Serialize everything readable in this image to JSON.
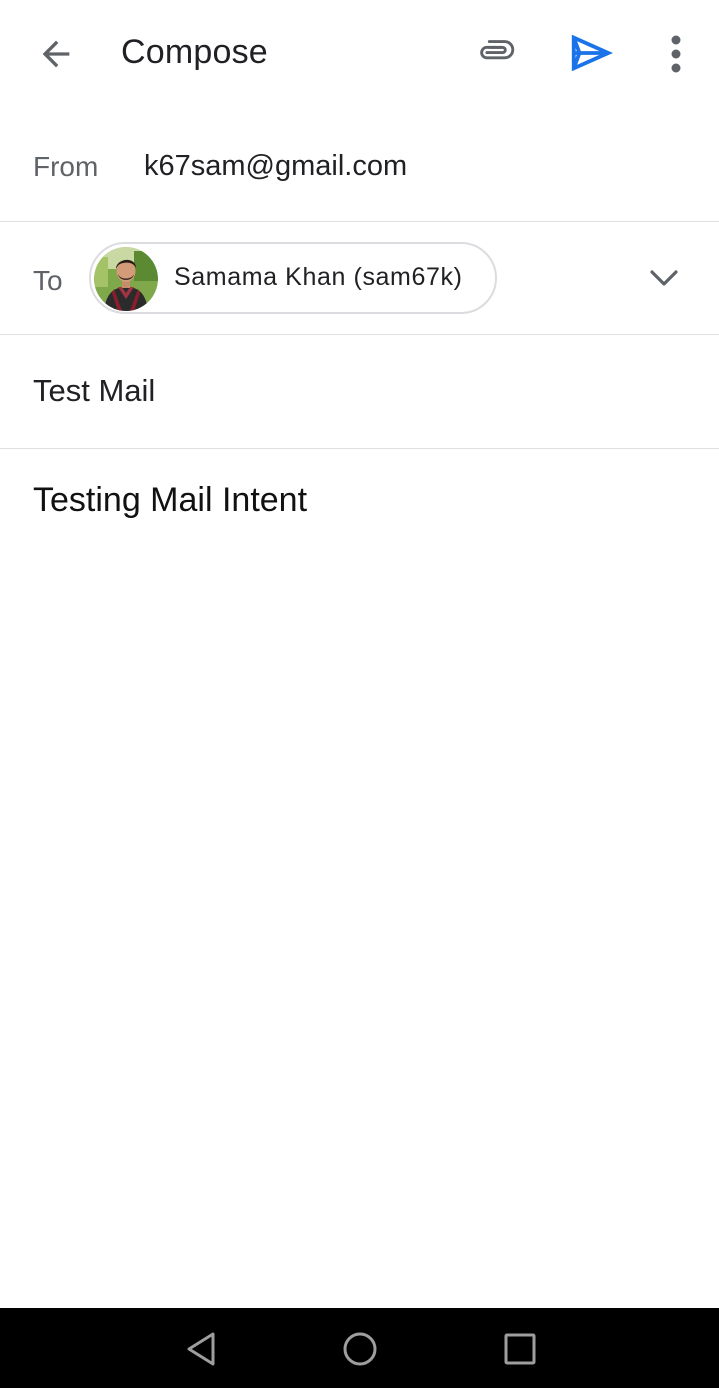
{
  "header": {
    "title": "Compose",
    "icons": {
      "back": "arrow-back-icon",
      "attach": "paperclip-icon",
      "send": "send-icon",
      "more": "more-vert-icon"
    },
    "send_color": "#1a73e8"
  },
  "from": {
    "label": "From",
    "value": "k67sam@gmail.com"
  },
  "to": {
    "label": "To",
    "recipients": [
      {
        "display": "Samama Khan (sam67k)",
        "avatar": "avatar-photo"
      }
    ],
    "expand_icon": "chevron-down-icon"
  },
  "subject": {
    "value": "Test Mail"
  },
  "body": {
    "text": "Testing Mail Intent"
  },
  "system_nav": {
    "back": "nav-back-icon",
    "home": "nav-home-icon",
    "recents": "nav-recents-icon"
  }
}
